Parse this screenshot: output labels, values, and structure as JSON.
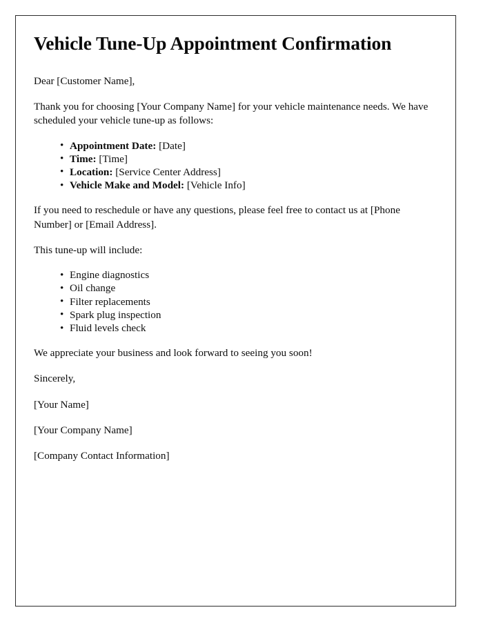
{
  "document": {
    "title": "Vehicle Tune-Up Appointment Confirmation",
    "salutation": "Dear [Customer Name],",
    "intro_paragraph": "Thank you for choosing [Your Company Name] for your vehicle maintenance needs. We have scheduled your vehicle tune-up as follows:",
    "appointment_details": [
      {
        "label": "Appointment Date:",
        "value": "[Date]"
      },
      {
        "label": "Time:",
        "value": "[Time]"
      },
      {
        "label": "Location:",
        "value": "[Service Center Address]"
      },
      {
        "label": "Vehicle Make and Model:",
        "value": "[Vehicle Info]"
      }
    ],
    "contact_paragraph": "If you need to reschedule or have any questions, please feel free to contact us at [Phone Number] or [Email Address].",
    "services_intro": "This tune-up will include:",
    "services": [
      "Engine diagnostics",
      "Oil change",
      "Filter replacements",
      "Spark plug inspection",
      "Fluid levels check"
    ],
    "appreciation_paragraph": "We appreciate your business and look forward to seeing you soon!",
    "closing": "Sincerely,",
    "signature_name": "[Your Name]",
    "signature_company": "[Your Company Name]",
    "signature_contact": "[Company Contact Information]"
  },
  "style": {
    "page_background": "#ffffff",
    "text_color": "#0d0d0d",
    "border_color": "#2b2b2b"
  }
}
